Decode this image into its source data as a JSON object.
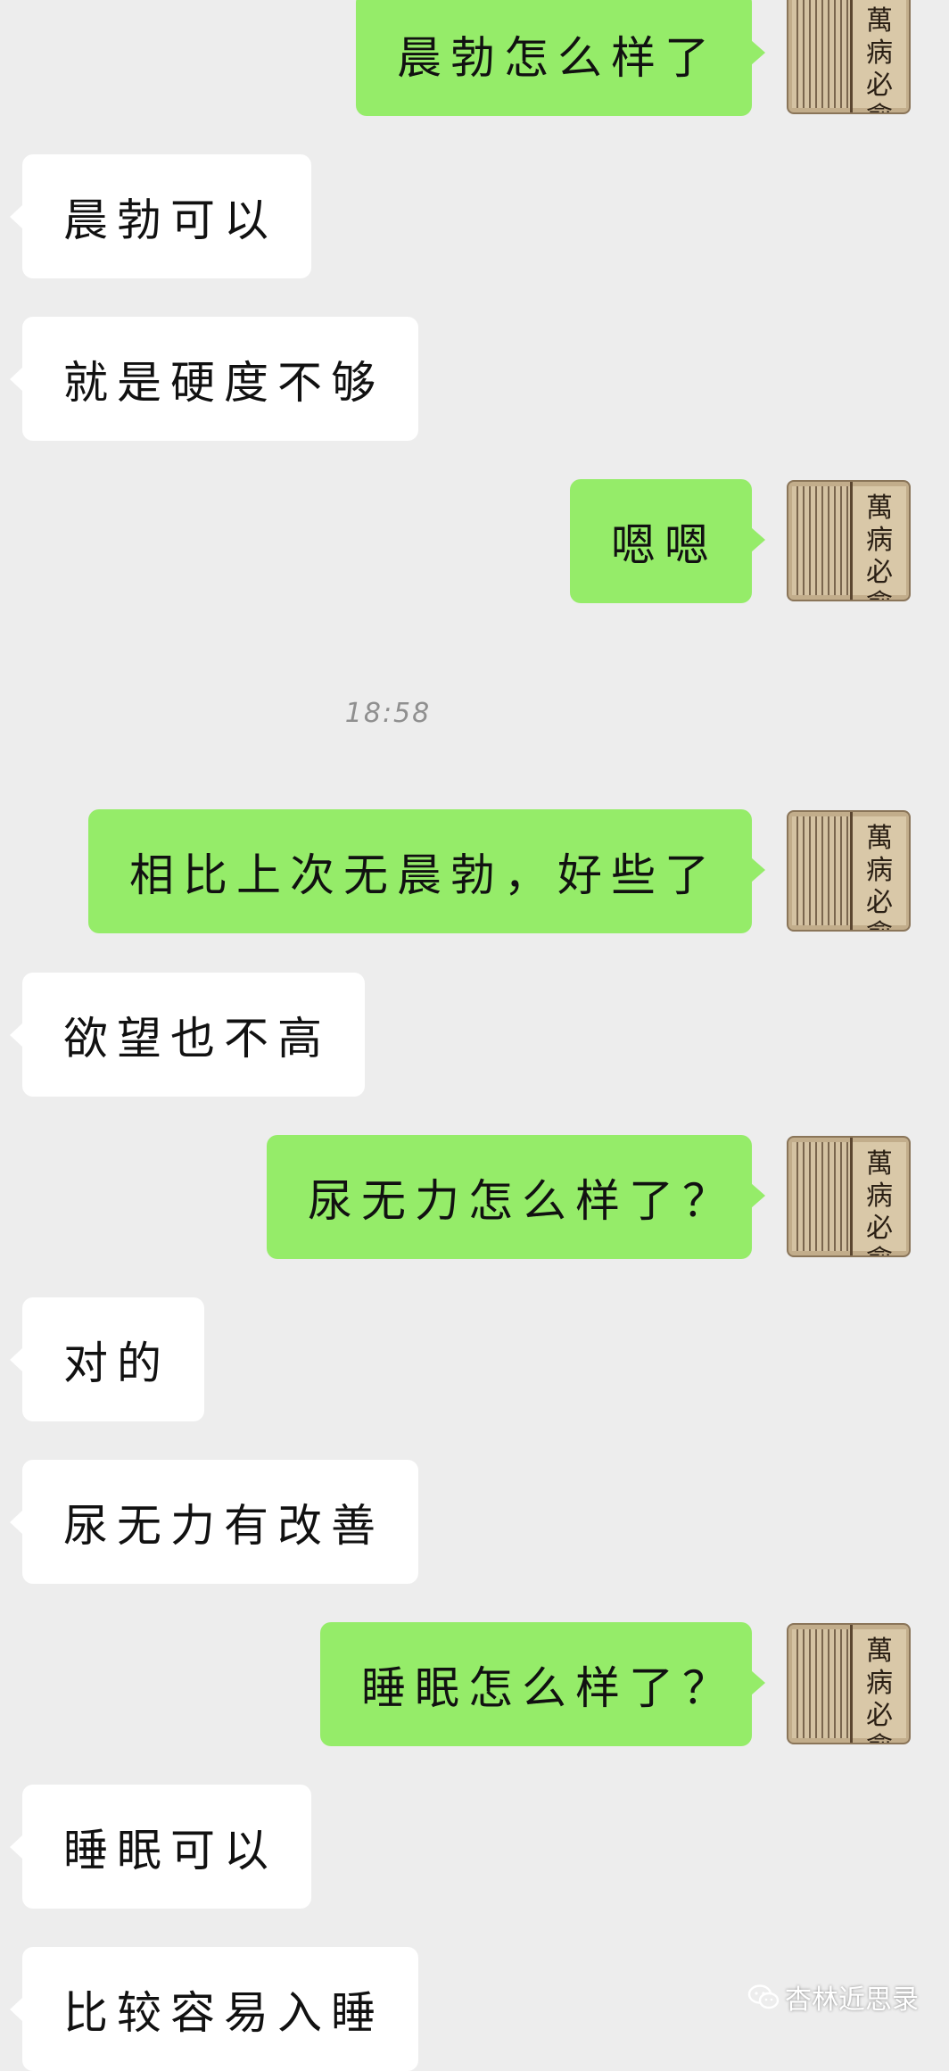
{
  "chat": {
    "messages": [
      {
        "side": "out",
        "text": "晨勃怎么样了"
      },
      {
        "side": "in",
        "text": "晨勃可以"
      },
      {
        "side": "in",
        "text": "就是硬度不够"
      },
      {
        "side": "out",
        "text": "嗯嗯"
      },
      {
        "side": "out",
        "text": "相比上次无晨勃，好些了"
      },
      {
        "side": "in",
        "text": "欲望也不高"
      },
      {
        "side": "out",
        "text": "尿无力怎么样了？"
      },
      {
        "side": "in",
        "text": "对的"
      },
      {
        "side": "in",
        "text": "尿无力有改善"
      },
      {
        "side": "out",
        "text": "睡眠怎么样了？"
      },
      {
        "side": "in",
        "text": "睡眠可以"
      },
      {
        "side": "in",
        "text": "比较容易入睡"
      }
    ],
    "timestamp": "18:58"
  },
  "avatar": {
    "title": "萬病必愈"
  },
  "watermark": {
    "text": "杏林近思录",
    "icon": "wechat-icon"
  },
  "colors": {
    "background": "#ededed",
    "outgoing_bubble": "#95ec69",
    "incoming_bubble": "#ffffff"
  }
}
